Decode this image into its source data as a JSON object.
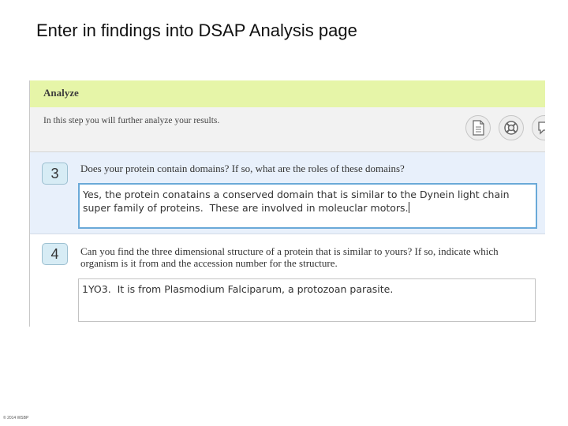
{
  "slide": {
    "title": "Enter in findings into DSAP Analysis page",
    "footer": "© 2014 WSBP"
  },
  "header": {
    "title": "Analyze"
  },
  "intro": {
    "text": "In this step you will further analyze your results."
  },
  "toolbar": {
    "icons": [
      "document-icon",
      "lifebuoy-icon",
      "speech-bubble-icon"
    ]
  },
  "questions": [
    {
      "number": "3",
      "text": "Does your protein contain domains? If so, what are the roles of these domains?",
      "answer": "Yes, the protein conatains a conserved domain that is similar to the Dynein light chain super family of proteins.  These are involved in moleuclar motors."
    },
    {
      "number": "4",
      "text": "Can you find the three dimensional structure of a protein that is similar to yours? If so, indicate which organism is it from and the accession number for the structure.",
      "answer": "1YO3.  It is from Plasmodium Falciparum, a protozoan parasite."
    }
  ],
  "colors": {
    "header_bg": "#e6f5a8",
    "active_question_bg": "#e8f0fb",
    "focus_border": "#6aa9d8"
  }
}
